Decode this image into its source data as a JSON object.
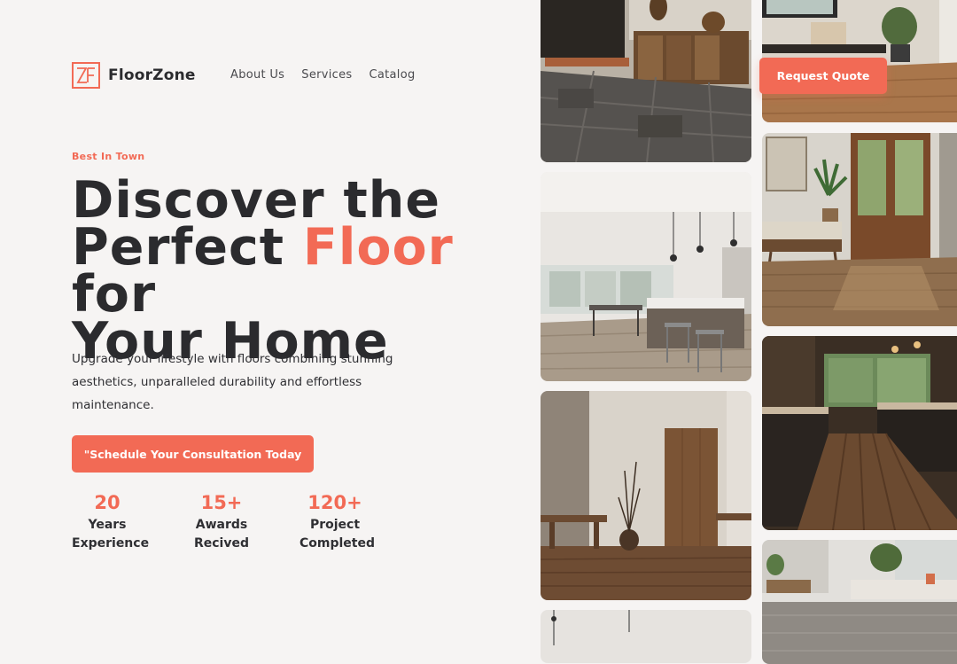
{
  "brand": {
    "name": "FloorZone",
    "logo_monogram": "ZF"
  },
  "nav": {
    "items": [
      "About Us",
      "Services",
      "Catalog"
    ]
  },
  "header": {
    "cta_label": "Request Quote"
  },
  "hero": {
    "eyebrow": "Best In Town",
    "title_line1": "Discover the",
    "title_line2_before": "Perfect ",
    "title_accent": "Floor",
    "title_line2_after": " for",
    "title_line3": "Your Home",
    "description": "Upgrade your lifestyle with floors combining stunning aesthetics, unparalleled durability and effortless maintenance.",
    "cta_label": "\"Schedule Your Consultation Today"
  },
  "stats": [
    {
      "value": "20",
      "label_line1": "Years",
      "label_line2": "Experience"
    },
    {
      "value": "15+",
      "label_line1": "Awards",
      "label_line2": "Recived"
    },
    {
      "value": "120+",
      "label_line1": "Project",
      "label_line2": "Completed"
    }
  ],
  "gallery": {
    "photos": [
      "entryway-with-stone-tile-floor",
      "open-kitchen-with-wood-floor",
      "room-with-wooden-door",
      "partial-interior-photo",
      "hallway-with-bench",
      "living-room-with-french-doors",
      "dark-kitchen-with-plank-floor",
      "living-room-with-polished-floor"
    ]
  },
  "colors": {
    "accent": "#f26a55",
    "text": "#2b2b2e",
    "background": "#f6f4f3"
  }
}
